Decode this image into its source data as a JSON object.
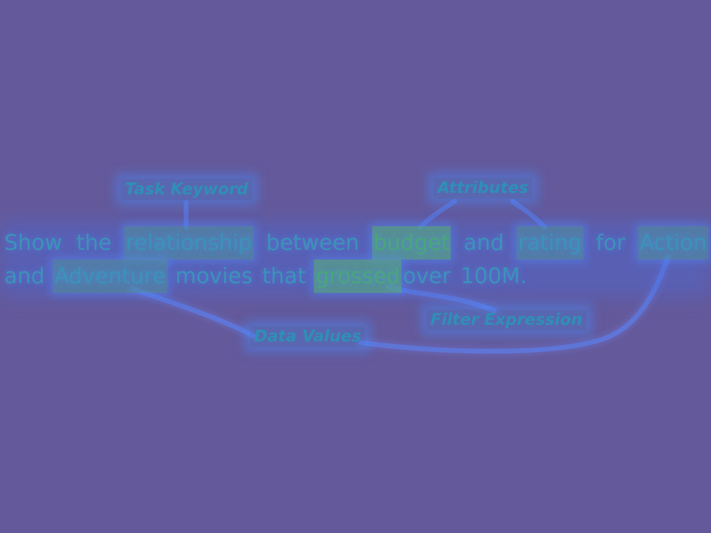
{
  "labels": {
    "task_keyword": "Task Keyword",
    "attributes": "Attributes",
    "filter_expression": "Filter Expression",
    "data_values": "Data Values"
  },
  "sentence": {
    "line1": [
      "Show",
      "the",
      "relationship",
      "between",
      "budget",
      "and",
      "rating",
      "for",
      "Action"
    ],
    "line2": [
      "and",
      "Adventure",
      "movies",
      "that",
      "grossed",
      "over",
      "100M",
      "."
    ]
  },
  "colors": {
    "background": "#64599a",
    "text": "#3b93b8",
    "highlight": "#4e949e",
    "hot_highlight": "#56aa82",
    "connector": "#5a78e0"
  }
}
